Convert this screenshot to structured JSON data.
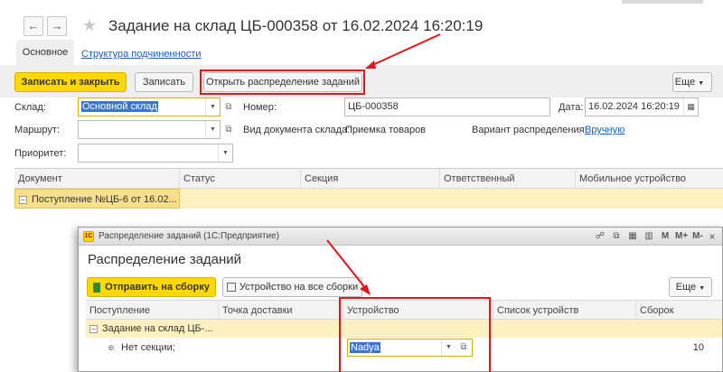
{
  "header": {
    "back_icon": "arrow-left-icon",
    "forward_icon": "arrow-right-icon",
    "favorite_icon": "star-icon",
    "title": "Задание на склад ЦБ-000358 от 16.02.2024 16:20:19"
  },
  "tabs": {
    "main": "Основное",
    "structure": "Структура подчиненности"
  },
  "toolbar": {
    "save_close": "Записать и закрыть",
    "save": "Записать",
    "open_distribution": "Открыть распределение заданий",
    "more": "Еще"
  },
  "form": {
    "warehouse_label": "Склад:",
    "warehouse_value": "Основной склад",
    "route_label": "Маршрут:",
    "route_value": "",
    "priority_label": "Приоритет:",
    "priority_value": "",
    "number_label": "Номер:",
    "number_value": "ЦБ-000358",
    "date_label": "Дата:",
    "date_value": "16.02.2024 16:20:19",
    "doc_kind_label": "Вид документа склада:",
    "doc_kind_value": "Приемка товаров",
    "variant_label": "Вариант распределения:",
    "variant_value": "Вручную"
  },
  "table1": {
    "columns": [
      "Документ",
      "Статус",
      "Секция",
      "Ответственный",
      "Мобильное устройство"
    ],
    "rows": [
      {
        "document": "Поступление №ЦБ-6 от 16.02...",
        "status": "",
        "section": "",
        "responsible": "",
        "device": ""
      }
    ]
  },
  "modal": {
    "window_title": "Распределение заданий (1С:Предприятие)",
    "title": "Распределение заданий",
    "send_button": "Отправить на сборку",
    "device_all_button": "Устройство на все сборки",
    "more": "Еще",
    "columns": [
      "Поступление",
      "Точка доставки",
      "Устройство",
      "Список устройств",
      "Сборок"
    ],
    "group_row": "Задание на склад ЦБ-...",
    "row": {
      "receipt": "Нет секции;",
      "device": "Nadya",
      "count": "10"
    }
  },
  "colors": {
    "accent_yellow": "#ffd800",
    "highlight_row": "#fdf1c1",
    "annotation_red": "#e8121c",
    "link_blue": "#1b5ec0"
  }
}
